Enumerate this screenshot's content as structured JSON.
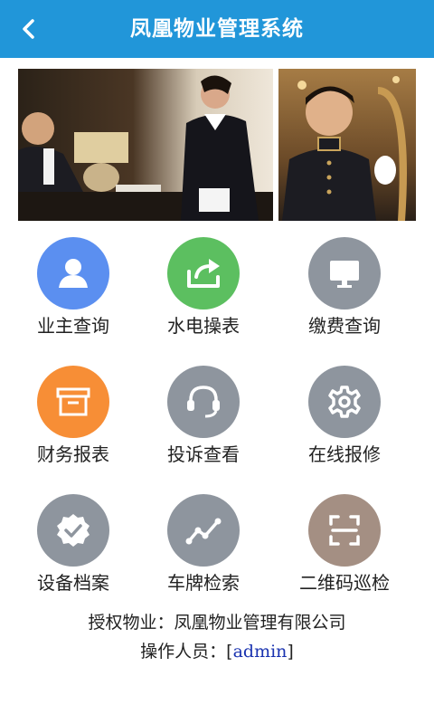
{
  "header": {
    "title": "凤凰物业管理系统",
    "back_icon": "chevron-left-icon"
  },
  "menu": [
    {
      "label": "业主查询",
      "icon": "person-icon",
      "color": "#5b8ff0"
    },
    {
      "label": "水电操表",
      "icon": "share-icon",
      "color": "#5cbf60"
    },
    {
      "label": "缴费查询",
      "icon": "monitor-icon",
      "color": "#8e959e"
    },
    {
      "label": "财务报表",
      "icon": "archive-box-icon",
      "color": "#f78e36"
    },
    {
      "label": "投诉查看",
      "icon": "headset-icon",
      "color": "#8e959e"
    },
    {
      "label": "在线报修",
      "icon": "gear-icon",
      "color": "#8e959e"
    },
    {
      "label": "设备档案",
      "icon": "check-badge-icon",
      "color": "#8e959e"
    },
    {
      "label": "车牌检索",
      "icon": "trend-line-icon",
      "color": "#8e959e"
    },
    {
      "label": "二维码巡检",
      "icon": "scan-frame-icon",
      "color": "#a48f83"
    }
  ],
  "footer": {
    "company_prefix": "授权物业：",
    "company": "凤凰物业管理有限公司",
    "operator_prefix": "操作人员：",
    "operator_open": "[",
    "operator": "admin",
    "operator_close": "]"
  }
}
